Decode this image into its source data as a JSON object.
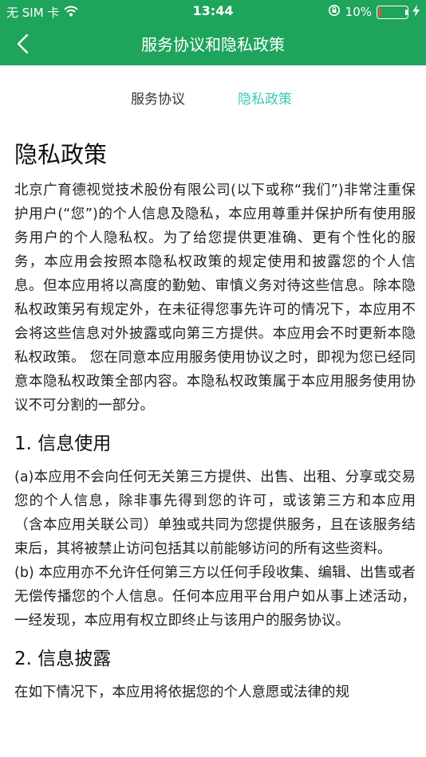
{
  "status_bar": {
    "carrier": "无 SIM 卡",
    "time": "13:44",
    "battery_percent_text": "10%",
    "battery_level": 0.1,
    "icons": [
      "wifi-icon",
      "orientation-lock-icon",
      "battery-icon",
      "charging-bolt-icon"
    ],
    "battery_color": "#ff4a3d"
  },
  "nav": {
    "title": "服务协议和隐私政策",
    "back_icon": "chevron-left-icon",
    "bar_color": "#1fa45c"
  },
  "tabs": [
    {
      "label": "服务协议",
      "active": false
    },
    {
      "label": "隐私政策",
      "active": true,
      "color": "#3cc7b7"
    }
  ],
  "content": {
    "title": "隐私政策",
    "intro": "北京广育德视觉技术股份有限公司(以下或称“我们”)非常注重保护用户(“您”)的个人信息及隐私，本应用尊重并保护所有使用服务用户的个人隐私权。为了给您提供更准确、更有个性化的服务，本应用会按照本隐私权政策的规定使用和披露您的个人信息。但本应用将以高度的勤勉、审慎义务对待这些信息。除本隐私权政策另有规定外，在未征得您事先许可的情况下，本应用不会将这些信息对外披露或向第三方提供。本应用会不时更新本隐私权政策。 您在同意本应用服务使用协议之时，即视为您已经同意本隐私权政策全部内容。本隐私权政策属于本应用服务使用协议不可分割的一部分。",
    "section1": {
      "title": "1. 信息使用",
      "para_a": "(a)本应用不会向任何无关第三方提供、出售、出租、分享或交易您的个人信息，除非事先得到您的许可，或该第三方和本应用（含本应用关联公司）单独或共同为您提供服务，且在该服务结束后，其将被禁止访问包括其以前能够访问的所有这些资料。",
      "para_b": "(b) 本应用亦不允许任何第三方以任何手段收集、编辑、出售或者无偿传播您的个人信息。任何本应用平台用户如从事上述活动，一经发现，本应用有权立即终止与该用户的服务协议。"
    },
    "section2": {
      "title": "2. 信息披露",
      "partial_text": "在如下情况下，本应用将依据您的个人意愿或法律的规"
    }
  }
}
